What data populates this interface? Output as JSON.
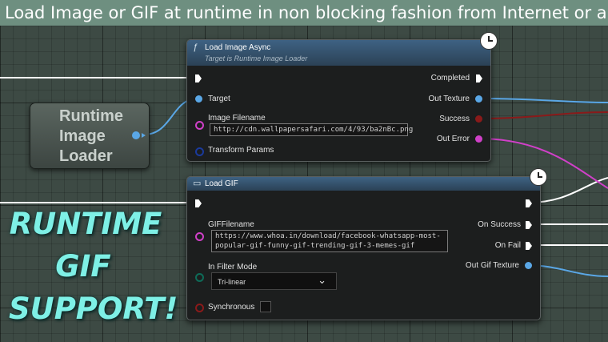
{
  "banner": {
    "title": "Load Image or GIF at runtime in non blocking fashion from Internet or a loca"
  },
  "variable_node": {
    "label": "Runtime\nImage\nLoader",
    "line1": "Runtime",
    "line2": "Image",
    "line3": "Loader"
  },
  "load_image_async": {
    "title": "Load Image Async",
    "subtitle": "Target is Runtime Image Loader",
    "icon": "function-icon",
    "pins_in": {
      "target": "Target",
      "image_filename": "Image Filename",
      "transform_params": "Transform Params"
    },
    "image_filename_value": "http://cdn.wallpapersafari.com/4/93/ba2nBc.png",
    "pins_out": {
      "completed": "Completed",
      "out_texture": "Out Texture",
      "success": "Success",
      "out_error": "Out Error"
    }
  },
  "load_gif": {
    "title": "Load GIF",
    "icon": "function-icon",
    "pins_in": {
      "gif_filename": "GIFFilename",
      "in_filter_mode": "In Filter Mode",
      "synchronous": "Synchronous"
    },
    "gif_filename_value": "https://www.whoa.in/download/facebook-whatsapp-most-popular-gif-funny-gif-trending-gif-3-memes-gif",
    "filter_mode_value": "Tri-linear",
    "pins_out": {
      "on_success": "On Success",
      "on_fail": "On Fail",
      "out_gif_texture": "Out Gif Texture"
    }
  },
  "overlay": {
    "line1": "RUNTIME",
    "line2": "GIF",
    "line3": "SUPPORT!"
  },
  "colors": {
    "background": "#3d4a44",
    "banner": "#6e8f80",
    "exec": "#ffffff",
    "object_pin": "#5aa7e6",
    "string_pin": "#d040c8",
    "bool_pin": "#8a1a1a",
    "enum_pin": "#0e6b58",
    "struct_pin": "#1a3a9c",
    "overlay_text": "#7ef0e6"
  }
}
